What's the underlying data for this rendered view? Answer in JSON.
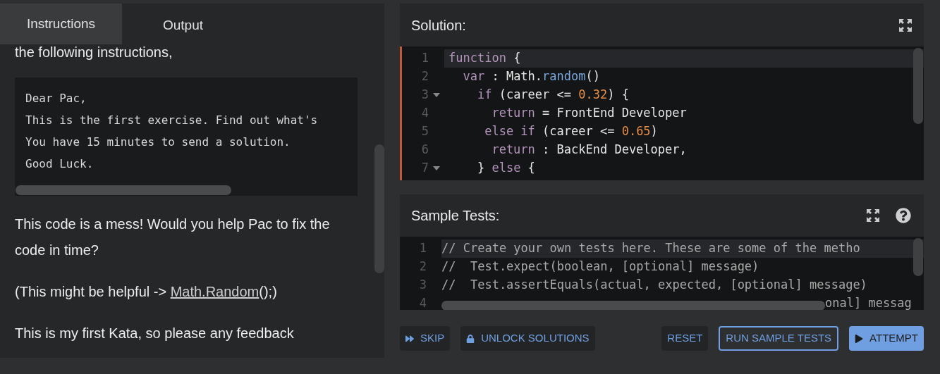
{
  "tabs": [
    {
      "label": "Instructions",
      "selected": true
    },
    {
      "label": "Output",
      "selected": false
    }
  ],
  "instructions": {
    "intro": "the following instructions,",
    "code_block": [
      "Dear Pac,",
      "This is the first exercise. Find out what's",
      "You have 15 minutes to send a solution.",
      "Good Luck."
    ],
    "paragraphs": [
      {
        "text": "This code is a mess! Would you help Pac to fix the code in time?"
      },
      {
        "text": "(This might be helpful -> ",
        "link": "Math.Random",
        "after": "();)"
      },
      {
        "text": "This is my first Kata, so please any feedback"
      }
    ]
  },
  "solution": {
    "title": "Solution:",
    "lines": [
      {
        "number": "1",
        "foldable": false,
        "current": true,
        "tokens": [
          {
            "kind": "keyword",
            "text": "function"
          },
          {
            "kind": "plain",
            "text": " {"
          }
        ]
      },
      {
        "number": "2",
        "foldable": false,
        "current": false,
        "tokens": [
          {
            "kind": "keyword",
            "text": "  var"
          },
          {
            "kind": "plain",
            "text": " : Math."
          },
          {
            "kind": "method",
            "text": "random"
          },
          {
            "kind": "plain",
            "text": "()"
          }
        ]
      },
      {
        "number": "3",
        "foldable": true,
        "current": false,
        "tokens": [
          {
            "kind": "keyword",
            "text": "    if"
          },
          {
            "kind": "plain",
            "text": " (career <= "
          },
          {
            "kind": "number",
            "text": "0.32"
          },
          {
            "kind": "plain",
            "text": ") {"
          }
        ]
      },
      {
        "number": "4",
        "foldable": false,
        "current": false,
        "tokens": [
          {
            "kind": "keyword",
            "text": "      return"
          },
          {
            "kind": "plain",
            "text": " = FrontEnd Developer"
          }
        ]
      },
      {
        "number": "5",
        "foldable": false,
        "current": false,
        "tokens": [
          {
            "kind": "keyword",
            "text": "     else if"
          },
          {
            "kind": "plain",
            "text": " (career <= "
          },
          {
            "kind": "number",
            "text": "0.65"
          },
          {
            "kind": "plain",
            "text": ")"
          }
        ]
      },
      {
        "number": "6",
        "foldable": false,
        "current": false,
        "tokens": [
          {
            "kind": "keyword",
            "text": "      return"
          },
          {
            "kind": "plain",
            "text": " : BackEnd Developer,"
          }
        ]
      },
      {
        "number": "7",
        "foldable": true,
        "current": false,
        "tokens": [
          {
            "kind": "plain",
            "text": "    } "
          },
          {
            "kind": "keyword",
            "text": "else"
          },
          {
            "kind": "plain",
            "text": " {"
          }
        ]
      }
    ]
  },
  "sample_tests": {
    "title": "Sample Tests:",
    "lines": [
      {
        "number": "1",
        "current": true,
        "text": "// Create your own tests here. These are some of the metho"
      },
      {
        "number": "2",
        "current": false,
        "text": "//  Test.expect(boolean, [optional] message)"
      },
      {
        "number": "3",
        "current": false,
        "text": "//  Test.assertEquals(actual, expected, [optional] message)"
      },
      {
        "number": "4",
        "current": false,
        "text": "onal] messag"
      }
    ]
  },
  "buttons": [
    {
      "label": "SKIP",
      "kind": "skip"
    },
    {
      "label": "UNLOCK SOLUTIONS",
      "kind": "unlock"
    },
    {
      "label": "RESET",
      "kind": "reset"
    },
    {
      "label": "RUN SAMPLE TESTS",
      "kind": "run"
    },
    {
      "label": "ATTEMPT",
      "kind": "attempt"
    }
  ]
}
